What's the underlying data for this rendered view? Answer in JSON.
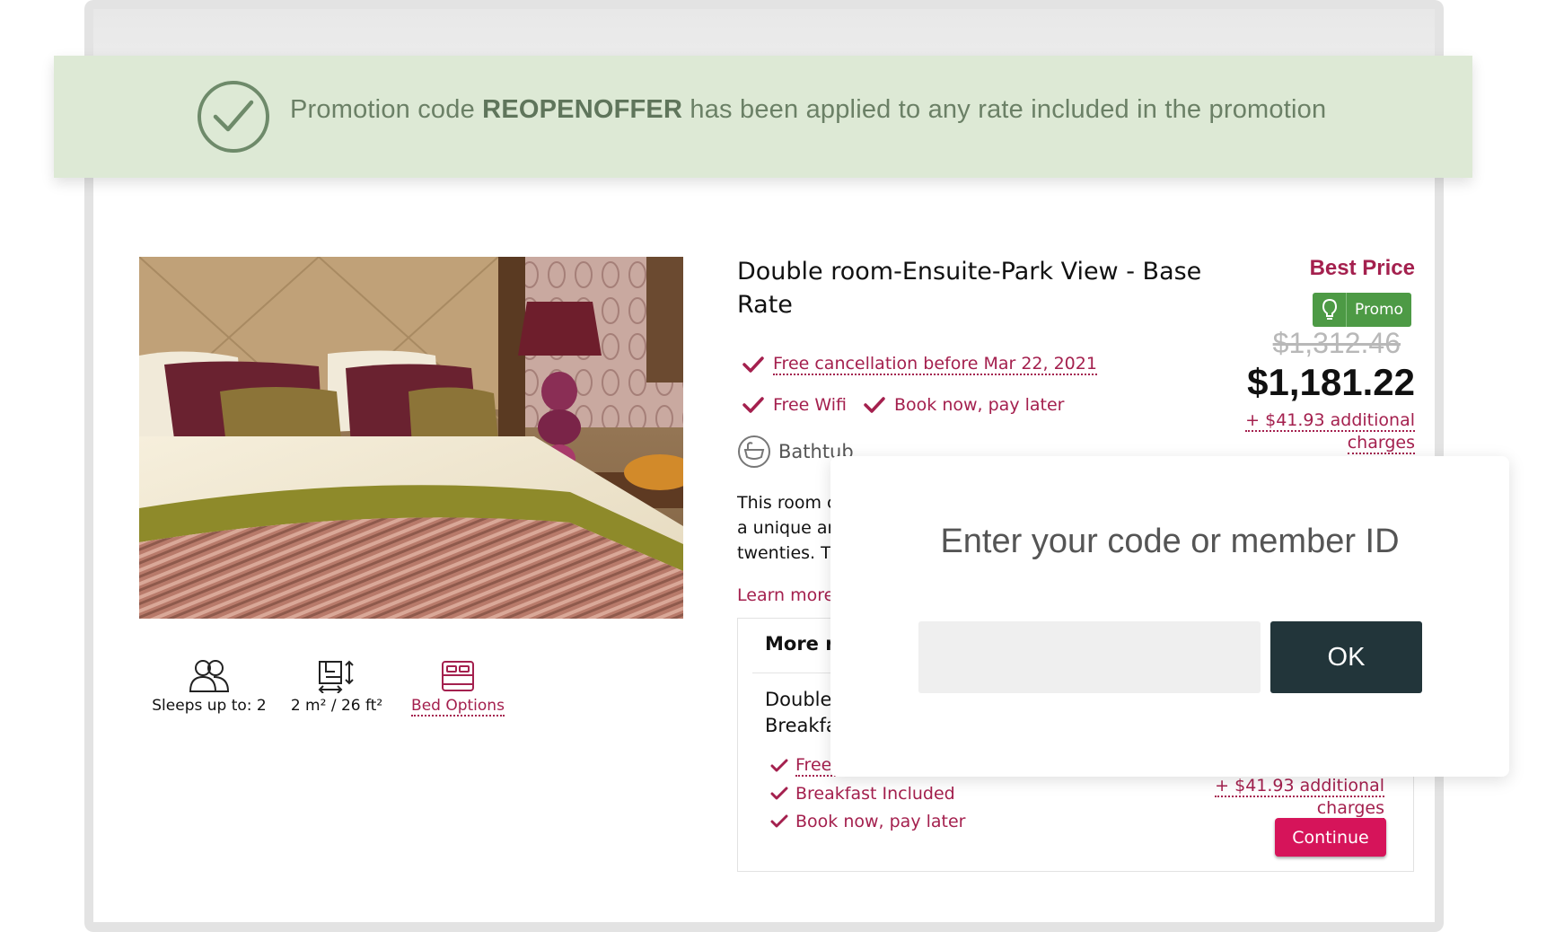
{
  "promo_banner": {
    "text_prefix": "Promotion code ",
    "code": "REOPENOFFER",
    "text_suffix": " has been applied to any rate included in the promotion"
  },
  "room": {
    "title": "Double room-Ensuite-Park View - Base Rate",
    "features": {
      "cancellation": "Free cancellation before Mar 22, 2021",
      "wifi": "Free Wifi",
      "book_now": "Book now, pay later"
    },
    "bathtub": "Bathtub",
    "description": "This room c\na unique ar\ntwenties. Th",
    "learn_more": "Learn more",
    "amenities": {
      "sleeps": "Sleeps up to: 2",
      "size": "2 m² / 26 ft²",
      "bed_options": "Bed Options"
    }
  },
  "pricing": {
    "best_price": "Best Price",
    "promo_badge": "Promo",
    "old_price": "$1,312.46",
    "new_price": "$1,181.22",
    "additional_charges_line1": "+ $41.93 additional",
    "additional_charges_line2": "charges"
  },
  "more_rates": {
    "title": "More ra",
    "rate_name_line1": "Double",
    "rate_name_line2": "Breakfa",
    "features": [
      "Free",
      "Breakfast Included",
      "Book now, pay later"
    ],
    "additional_charges_line1": "+ $41.93 additional",
    "additional_charges_line2": "charges",
    "continue_label": "Continue"
  },
  "code_popup": {
    "title": "Enter your code or member ID",
    "input_value": "",
    "ok_label": "OK"
  },
  "colors": {
    "accent": "#a4204e",
    "button_pink": "#d6145a",
    "promo_green": "#4d9a45",
    "banner_bg": "#dde9d5",
    "ok_button": "#22353a"
  }
}
